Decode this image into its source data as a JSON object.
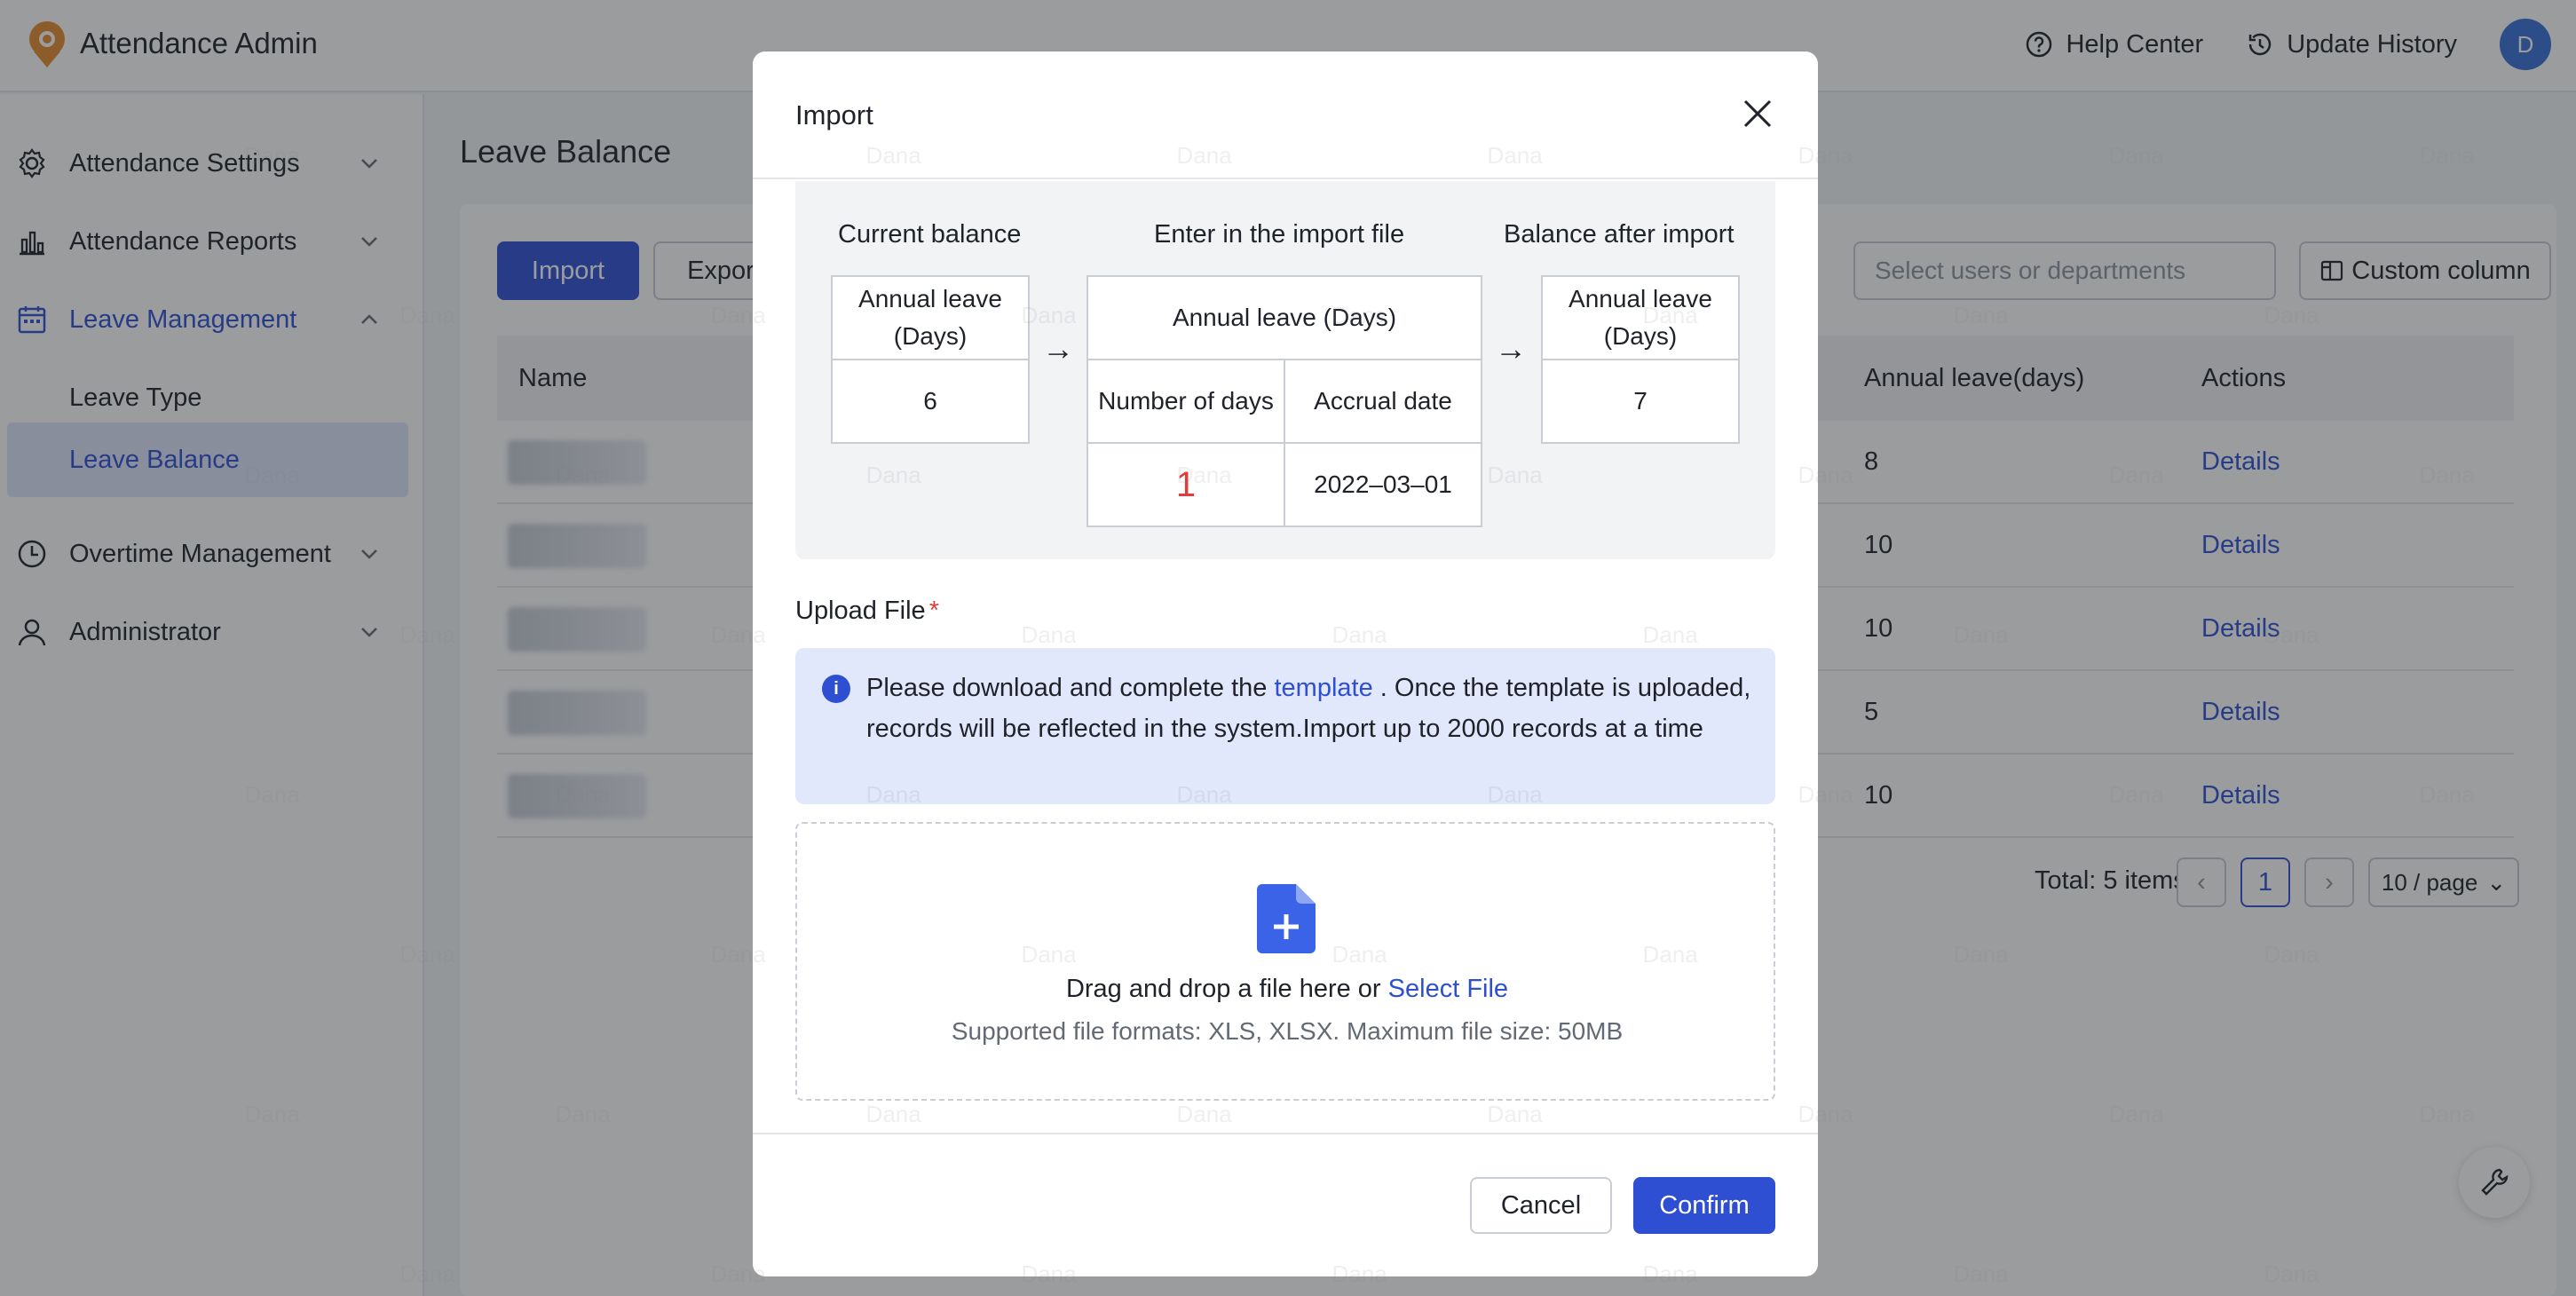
{
  "app": {
    "title": "Attendance Admin",
    "avatar_initial": "D"
  },
  "topbar": {
    "help_label": "Help Center",
    "history_label": "Update History"
  },
  "sidebar": {
    "items": [
      {
        "label": "Attendance Settings",
        "icon": "gear-icon"
      },
      {
        "label": "Attendance Reports",
        "icon": "chart-icon"
      },
      {
        "label": "Leave Management",
        "icon": "calendar-icon"
      },
      {
        "label": "Leave Type"
      },
      {
        "label": "Leave Balance"
      },
      {
        "label": "Overtime Management",
        "icon": "clock-icon"
      },
      {
        "label": "Administrator",
        "icon": "user-icon"
      }
    ]
  },
  "page": {
    "title": "Leave Balance",
    "import_label": "Import",
    "export_label": "Export",
    "select_placeholder": "Select users or departments",
    "custom_column_label": "Custom column",
    "columns": {
      "name": "Name",
      "annual": "Annual leave(days)",
      "actions": "Actions"
    },
    "rows": [
      {
        "annual": "8",
        "action": "Details"
      },
      {
        "annual": "10",
        "action": "Details"
      },
      {
        "annual": "10",
        "action": "Details"
      },
      {
        "annual": "5",
        "action": "Details"
      },
      {
        "annual": "10",
        "action": "Details"
      }
    ],
    "pagination": {
      "total": "Total: 5 items",
      "current": "1",
      "per_page": "10 / page"
    }
  },
  "modal": {
    "title": "Import",
    "example": {
      "current_label": "Current balance",
      "enter_label": "Enter in the import file",
      "after_label": "Balance after import",
      "annual_days": "Annual leave (Days)",
      "current_value": "6",
      "number_of_days": "Number of days",
      "accrual_date": "Accrual date",
      "import_days": "1",
      "import_date": "2022–03–01",
      "after_value": "7"
    },
    "upload_label": "Upload File",
    "required_mark": "*",
    "info": {
      "before": "Please download and complete the ",
      "link": "template",
      "after": " . Once the template is uploaded, records will be reflected in the system.Import up to 2000 records at a time"
    },
    "dropzone": {
      "text": "Drag and drop a file here or ",
      "link": "Select File",
      "hint": "Supported file formats: XLS, XLSX. Maximum file size: 50MB"
    },
    "cancel_label": "Cancel",
    "confirm_label": "Confirm"
  },
  "watermark_text": "Dana",
  "colors": {
    "primary": "#2f4fd3",
    "accent_red": "#e23b3b",
    "info_bg": "#e1e8fc"
  }
}
